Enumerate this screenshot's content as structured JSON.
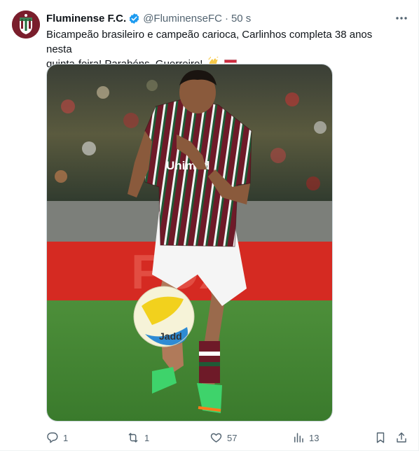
{
  "tweet": {
    "author_name": "Fluminense F.C.",
    "handle": "@FluminenseFC",
    "separator": "·",
    "time": "50 s",
    "text_line1": "Bicampeão brasileiro e campeão carioca, Carlinhos completa 38 anos nesta",
    "text_line2": "quinta-feira! Parabéns, Guerreiro!",
    "emojis": [
      "clapping-hands",
      "flag-hungary"
    ],
    "media": {
      "jersey_sponsor": "Unimed",
      "ball_brand": "Jadd",
      "billboard_text": "FOX"
    }
  },
  "actions": {
    "replies": "1",
    "reposts": "1",
    "likes": "57",
    "views": "13"
  },
  "colors": {
    "verified": "#1d9bf0",
    "muted": "#536471",
    "club_maroon": "#7a1e2c",
    "club_green": "#1f6b3a"
  }
}
